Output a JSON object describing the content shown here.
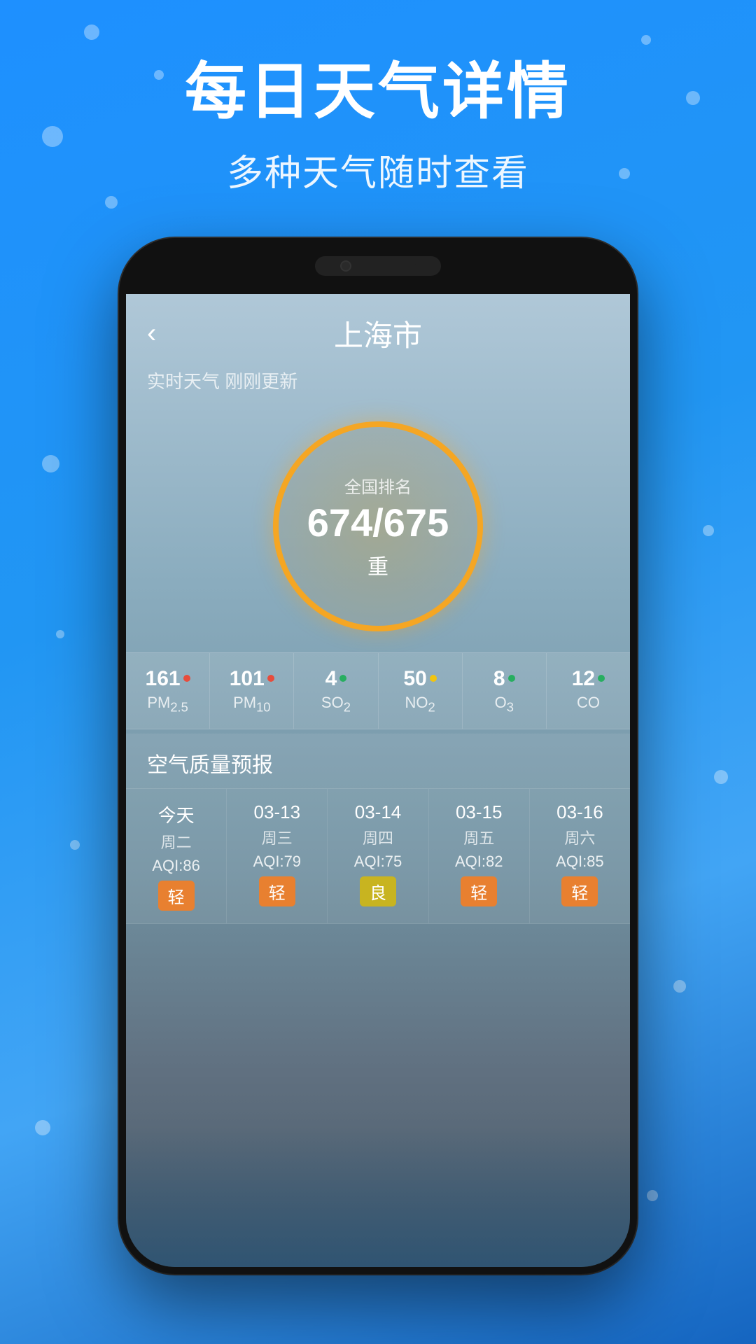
{
  "page": {
    "background_color": "#1e90ff",
    "title_line1": "每日天气详情",
    "title_line2": "多种天气随时查看"
  },
  "app": {
    "back_icon": "‹",
    "city": "上海市",
    "update_text": "实时天气 刚刚更新",
    "aqi_circle": {
      "rank_label": "全国排名",
      "rank_value": "674/675",
      "level": "重"
    },
    "pollutants": [
      {
        "value": "161",
        "dot_color": "red",
        "name": "PM₂.₅"
      },
      {
        "value": "101",
        "dot_color": "red",
        "name": "PM₁₀"
      },
      {
        "value": "4",
        "dot_color": "green",
        "name": "SO₂"
      },
      {
        "value": "50",
        "dot_color": "yellow",
        "name": "NO₂"
      },
      {
        "value": "8",
        "dot_color": "green",
        "name": "O₃"
      },
      {
        "value": "12",
        "dot_color": "green",
        "name": "CO"
      }
    ],
    "forecast": {
      "section_title": "空气质量预报",
      "days": [
        {
          "date": "今天",
          "weekday": "周二",
          "aqi": "AQI:86",
          "level": "轻",
          "badge": "orange"
        },
        {
          "date": "03-13",
          "weekday": "周三",
          "aqi": "AQI:79",
          "level": "轻",
          "badge": "orange"
        },
        {
          "date": "03-14",
          "weekday": "周四",
          "aqi": "AQI:75",
          "level": "良",
          "badge": "yellow"
        },
        {
          "date": "03-15",
          "weekday": "周五",
          "aqi": "AQI:82",
          "level": "轻",
          "badge": "orange"
        },
        {
          "date": "03-16",
          "weekday": "周六",
          "aqi": "AQI:85",
          "level": "轻",
          "badge": "orange"
        }
      ]
    }
  }
}
